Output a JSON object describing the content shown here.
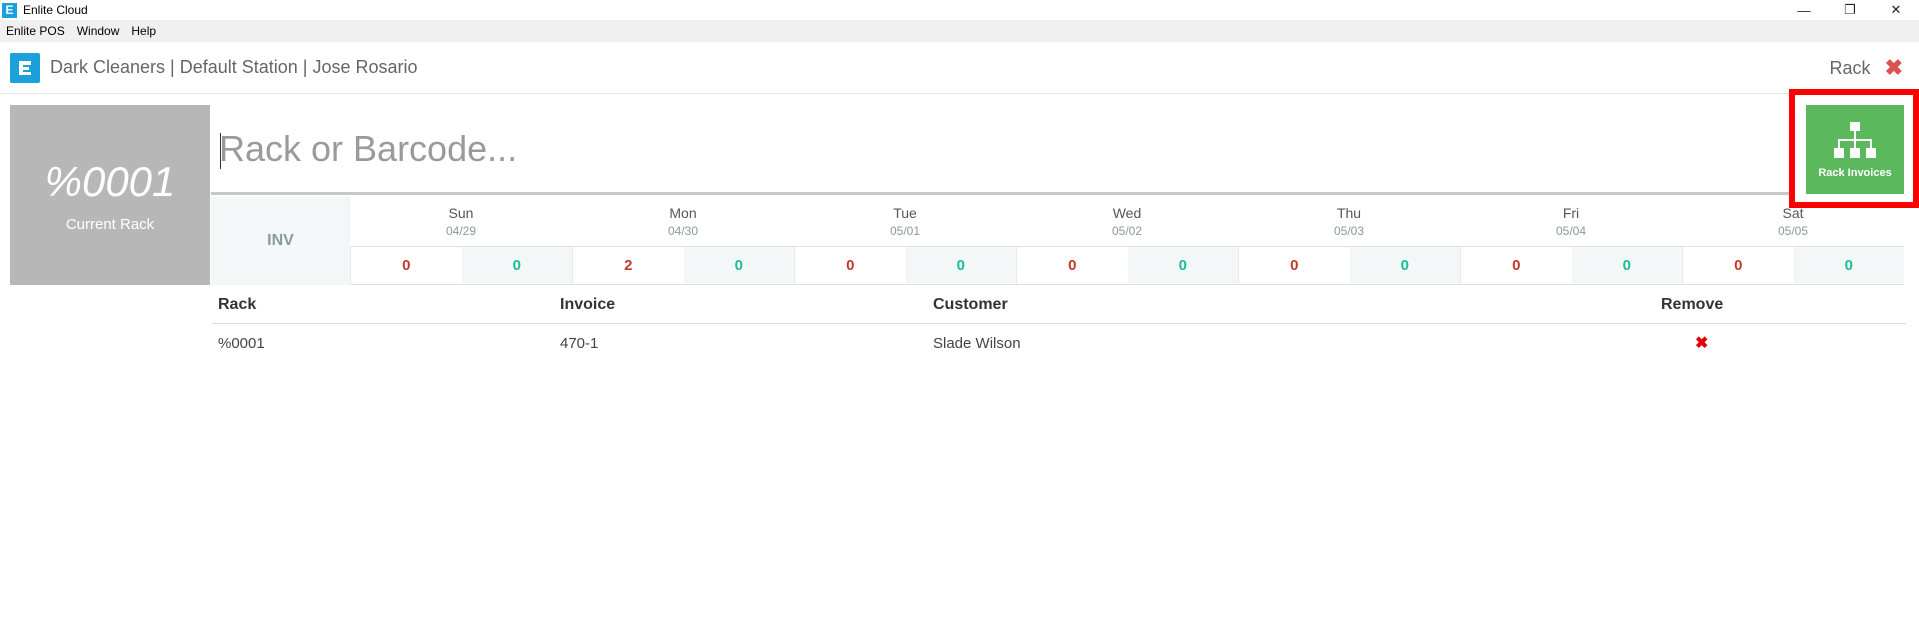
{
  "window": {
    "title": "Enlite Cloud",
    "icon_letter": "E",
    "controls": [
      "—",
      "❐",
      "✕"
    ]
  },
  "menubar": [
    "Enlite POS",
    "Window",
    "Help"
  ],
  "header": {
    "title": "Dark Cleaners | Default Station | Jose Rosario",
    "section": "Rack",
    "close": "✖"
  },
  "current_rack": {
    "code": "%0001",
    "label": "Current Rack"
  },
  "search": {
    "placeholder": "Rack or Barcode...",
    "value": ""
  },
  "rack_invoices_button": {
    "label": "Rack Invoices",
    "icon": "sitemap-icon"
  },
  "calendar": {
    "inv_label": "INV",
    "days": [
      {
        "name": "Sun",
        "date": "04/29",
        "a": "0",
        "b": "0"
      },
      {
        "name": "Mon",
        "date": "04/30",
        "a": "2",
        "b": "0"
      },
      {
        "name": "Tue",
        "date": "05/01",
        "a": "0",
        "b": "0"
      },
      {
        "name": "Wed",
        "date": "05/02",
        "a": "0",
        "b": "0"
      },
      {
        "name": "Thu",
        "date": "05/03",
        "a": "0",
        "b": "0"
      },
      {
        "name": "Fri",
        "date": "05/04",
        "a": "0",
        "b": "0"
      },
      {
        "name": "Sat",
        "date": "05/05",
        "a": "0",
        "b": "0"
      }
    ]
  },
  "table": {
    "headers": [
      "Rack",
      "Invoice",
      "Customer",
      "Remove"
    ],
    "rows": [
      {
        "rack": "%0001",
        "invoice": "470-1",
        "customer": "Slade Wilson",
        "remove": "✖"
      }
    ]
  },
  "colors": {
    "brand": "#1aa0db",
    "accent_green": "#5cb85c",
    "highlight": "#ff0000",
    "count_red": "#c0392b",
    "count_teal": "#1abc9c"
  }
}
